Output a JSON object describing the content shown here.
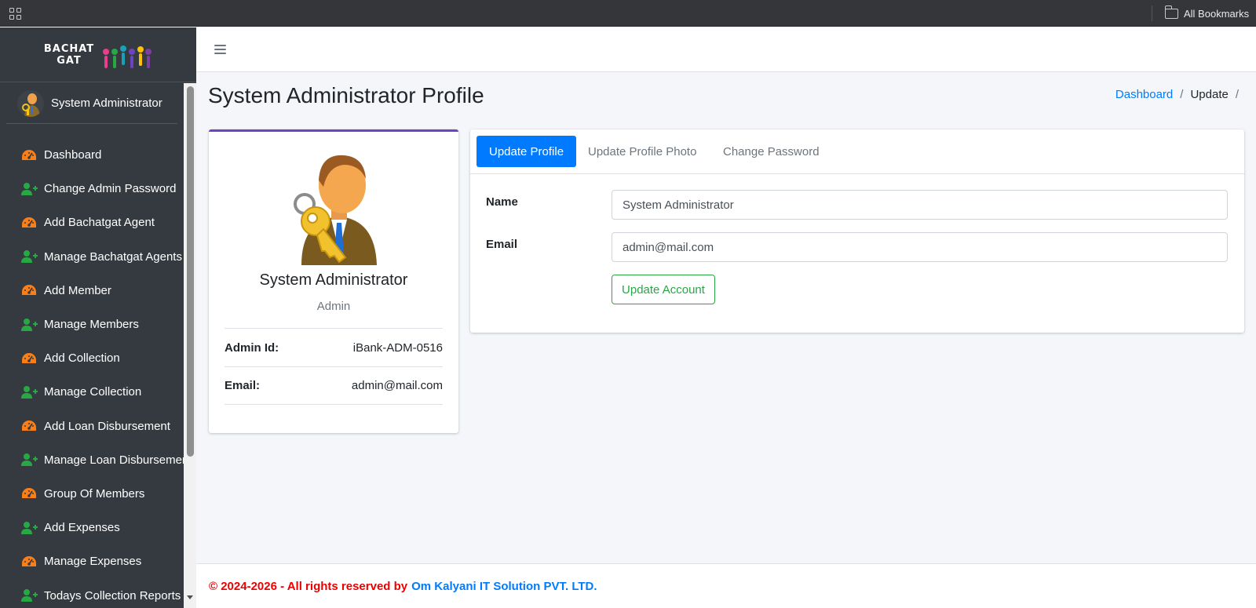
{
  "browser": {
    "bookmarks_label": "All Bookmarks"
  },
  "brand": {
    "line1": "BACHAT",
    "line2": "GAT"
  },
  "sidebar": {
    "user_name": "System Administrator",
    "items": [
      {
        "label": "Dashboard",
        "icon": "tachometer-icon"
      },
      {
        "label": "Change Admin Password",
        "icon": "user-plus-icon"
      },
      {
        "label": "Add Bachatgat Agent",
        "icon": "tachometer-icon"
      },
      {
        "label": "Manage Bachatgat Agents",
        "icon": "user-plus-icon"
      },
      {
        "label": "Add Member",
        "icon": "tachometer-icon"
      },
      {
        "label": "Manage Members",
        "icon": "user-plus-icon"
      },
      {
        "label": "Add Collection",
        "icon": "tachometer-icon"
      },
      {
        "label": "Manage Collection",
        "icon": "user-plus-icon"
      },
      {
        "label": "Add Loan Disbursement",
        "icon": "tachometer-icon"
      },
      {
        "label": "Manage Loan Disbursement",
        "icon": "user-plus-icon"
      },
      {
        "label": "Group Of Members",
        "icon": "tachometer-icon"
      },
      {
        "label": "Add Expenses",
        "icon": "user-plus-icon"
      },
      {
        "label": "Manage Expenses",
        "icon": "tachometer-icon"
      },
      {
        "label": "Todays Collection Reports",
        "icon": "user-plus-icon"
      }
    ]
  },
  "header": {
    "page_title": "System Administrator Profile",
    "breadcrumb": {
      "home": "Dashboard",
      "separator": "/",
      "current": "Update"
    }
  },
  "profile": {
    "name": "System Administrator",
    "role": "Admin",
    "admin_id_label": "Admin Id:",
    "admin_id_value": "iBank-ADM-0516",
    "email_label": "Email:",
    "email_value": "admin@mail.com"
  },
  "tabs": [
    {
      "label": "Update Profile",
      "active": true
    },
    {
      "label": "Update Profile Photo",
      "active": false
    },
    {
      "label": "Change Password",
      "active": false
    }
  ],
  "form": {
    "name_label": "Name",
    "name_value": "System Administrator",
    "email_label": "Email",
    "email_value": "admin@mail.com",
    "submit_label": "Update Account"
  },
  "footer": {
    "copyright": "© 2024-2026 - All rights reserved by",
    "company": "Om Kalyani IT Solution PVT. LTD."
  },
  "colors": {
    "sidebar_bg": "#343a40",
    "primary": "#007bff",
    "success": "#28a745",
    "card_accent": "#6f42c1",
    "icon_orange": "#fd7e14",
    "icon_green": "#28a745",
    "footer_red": "#e00000"
  }
}
